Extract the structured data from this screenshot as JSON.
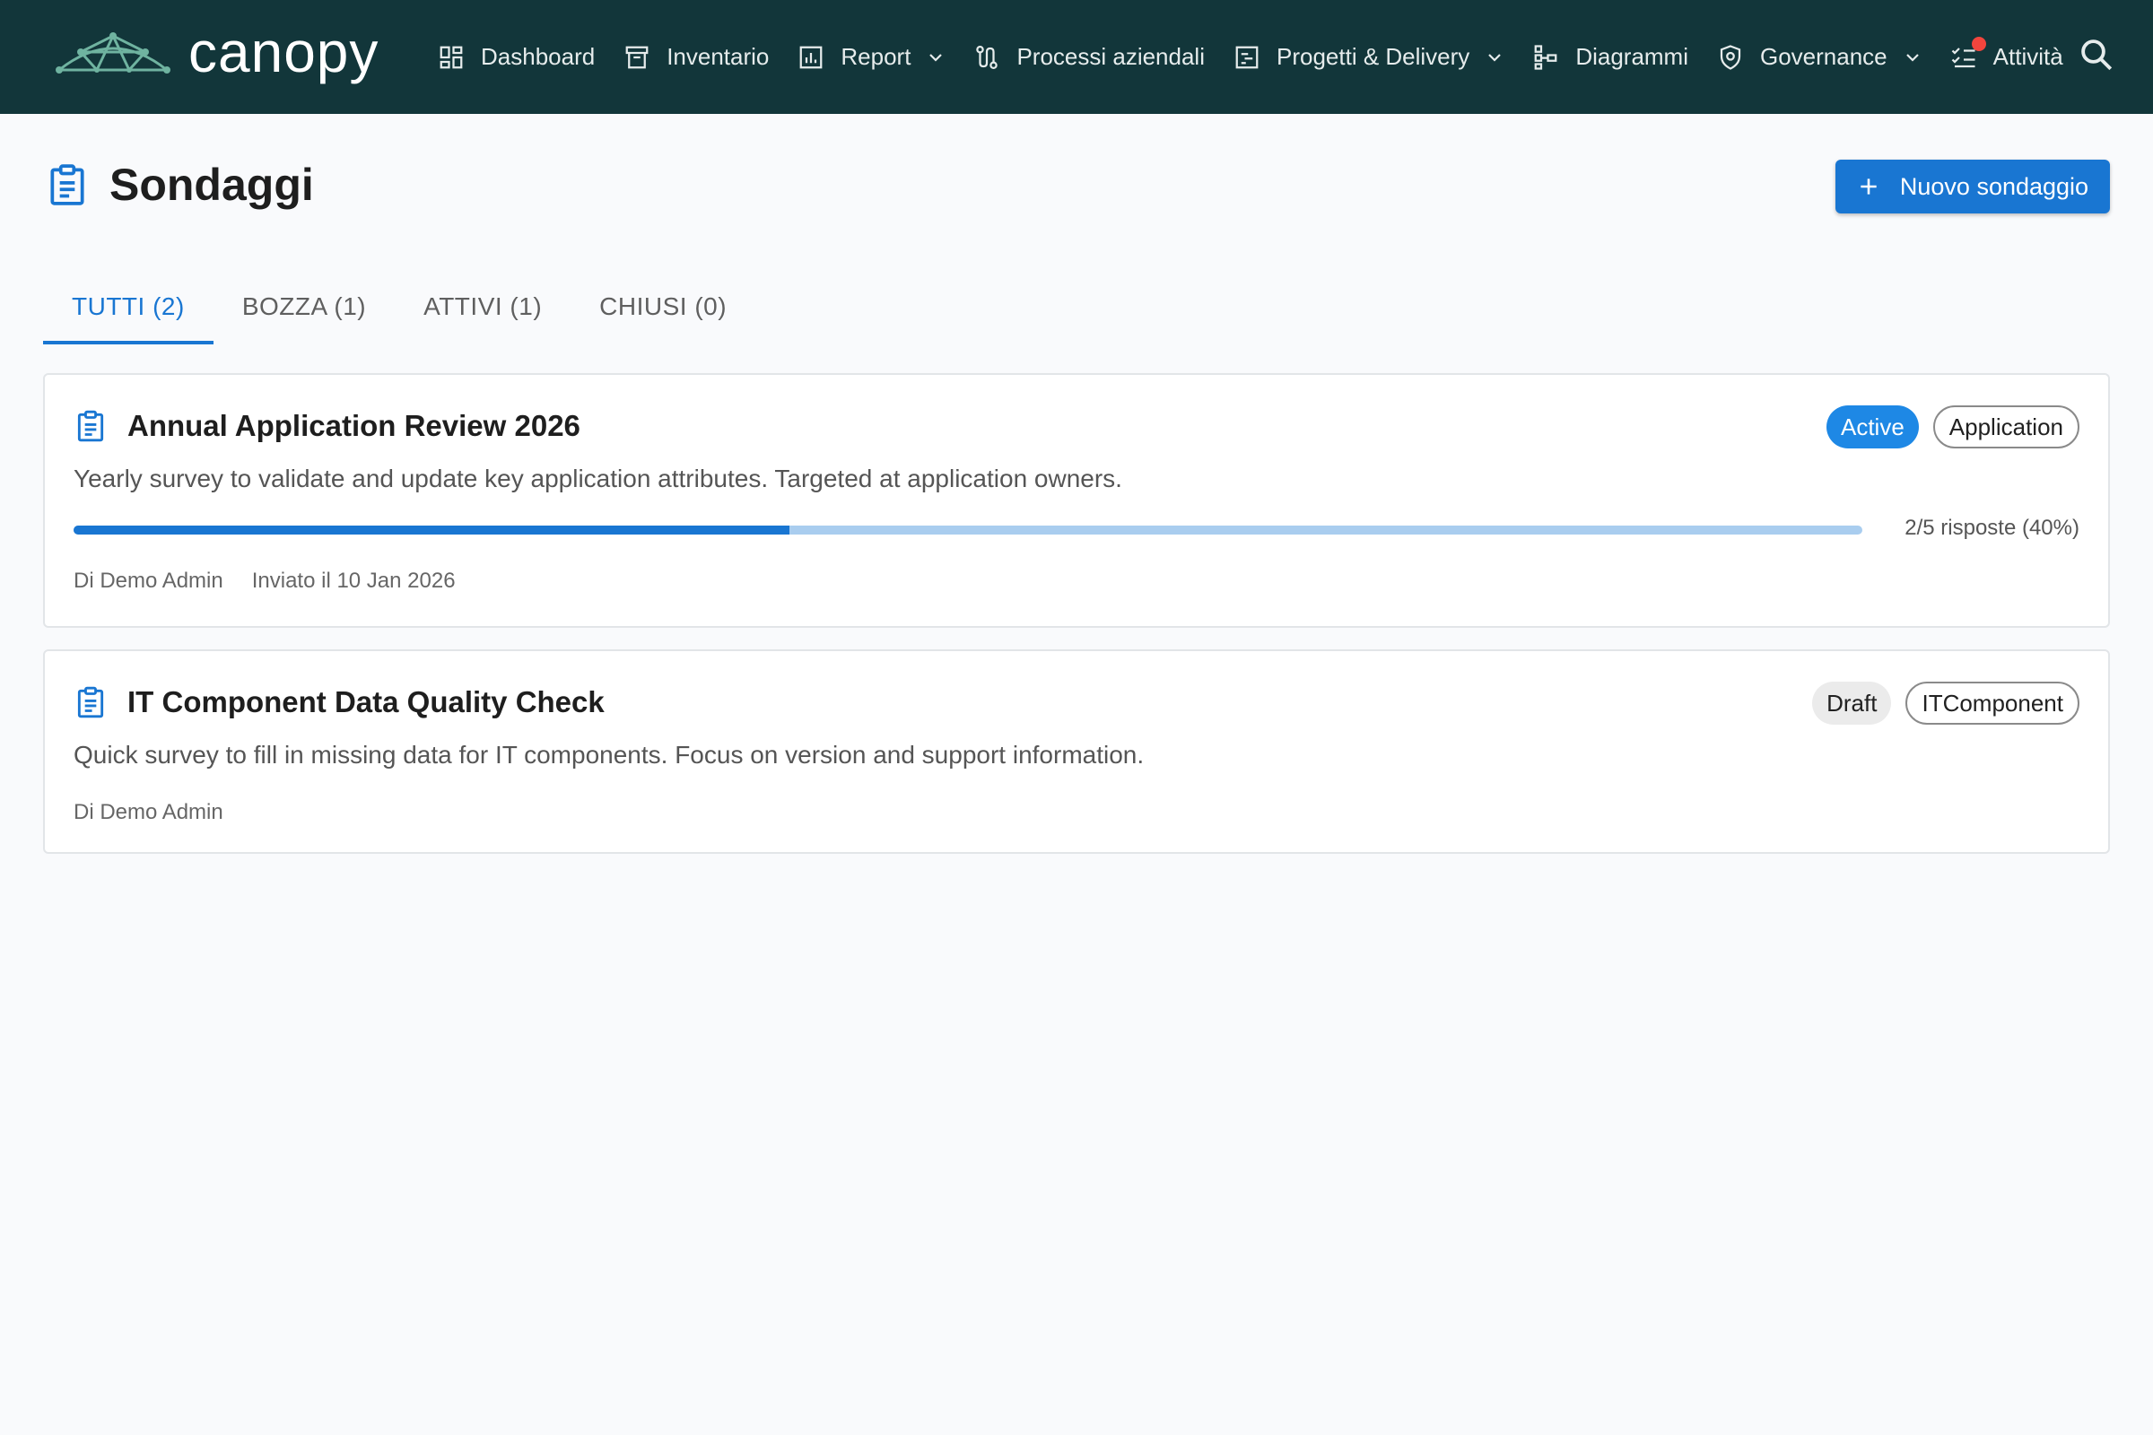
{
  "app": {
    "brand": "canopy",
    "colors": {
      "topbar": "#12363a",
      "accent": "#1976d2",
      "active_chip": "#1e88e5",
      "notification_dot": "#f2453d"
    }
  },
  "nav": {
    "items": [
      {
        "label": "Dashboard",
        "icon": "dashboard-icon",
        "dropdown": false
      },
      {
        "label": "Inventario",
        "icon": "archive-icon",
        "dropdown": false
      },
      {
        "label": "Report",
        "icon": "bar-chart-icon",
        "dropdown": true
      },
      {
        "label": "Processi aziendali",
        "icon": "route-icon",
        "dropdown": false
      },
      {
        "label": "Progetti & Delivery",
        "icon": "project-board-icon",
        "dropdown": true
      },
      {
        "label": "Diagrammi",
        "icon": "diagram-icon",
        "dropdown": false
      },
      {
        "label": "Governance",
        "icon": "shield-icon",
        "dropdown": true
      },
      {
        "label": "Attività",
        "icon": "checklist-icon",
        "dropdown": false,
        "notification": true
      }
    ],
    "search_icon": "search-icon"
  },
  "page": {
    "title": "Sondaggi",
    "icon": "clipboard-icon",
    "new_button": "Nuovo sondaggio"
  },
  "tabs": [
    {
      "label": "TUTTI (2)",
      "active": true
    },
    {
      "label": "BOZZA (1)",
      "active": false
    },
    {
      "label": "ATTIVI (1)",
      "active": false
    },
    {
      "label": "CHIUSI (0)",
      "active": false
    }
  ],
  "surveys": [
    {
      "title": "Annual Application Review 2026",
      "status": "Active",
      "type": "Application",
      "description": "Yearly survey to validate and update key application attributes. Targeted at application owners.",
      "progress_fraction": 0.4,
      "progress_text": "2/5 risposte (40%)",
      "author": "Di Demo Admin",
      "sent": "Inviato il 10 Jan 2026"
    },
    {
      "title": "IT Component Data Quality Check",
      "status": "Draft",
      "type": "ITComponent",
      "description": "Quick survey to fill in missing data for IT components. Focus on version and support information.",
      "author": "Di Demo Admin"
    }
  ]
}
